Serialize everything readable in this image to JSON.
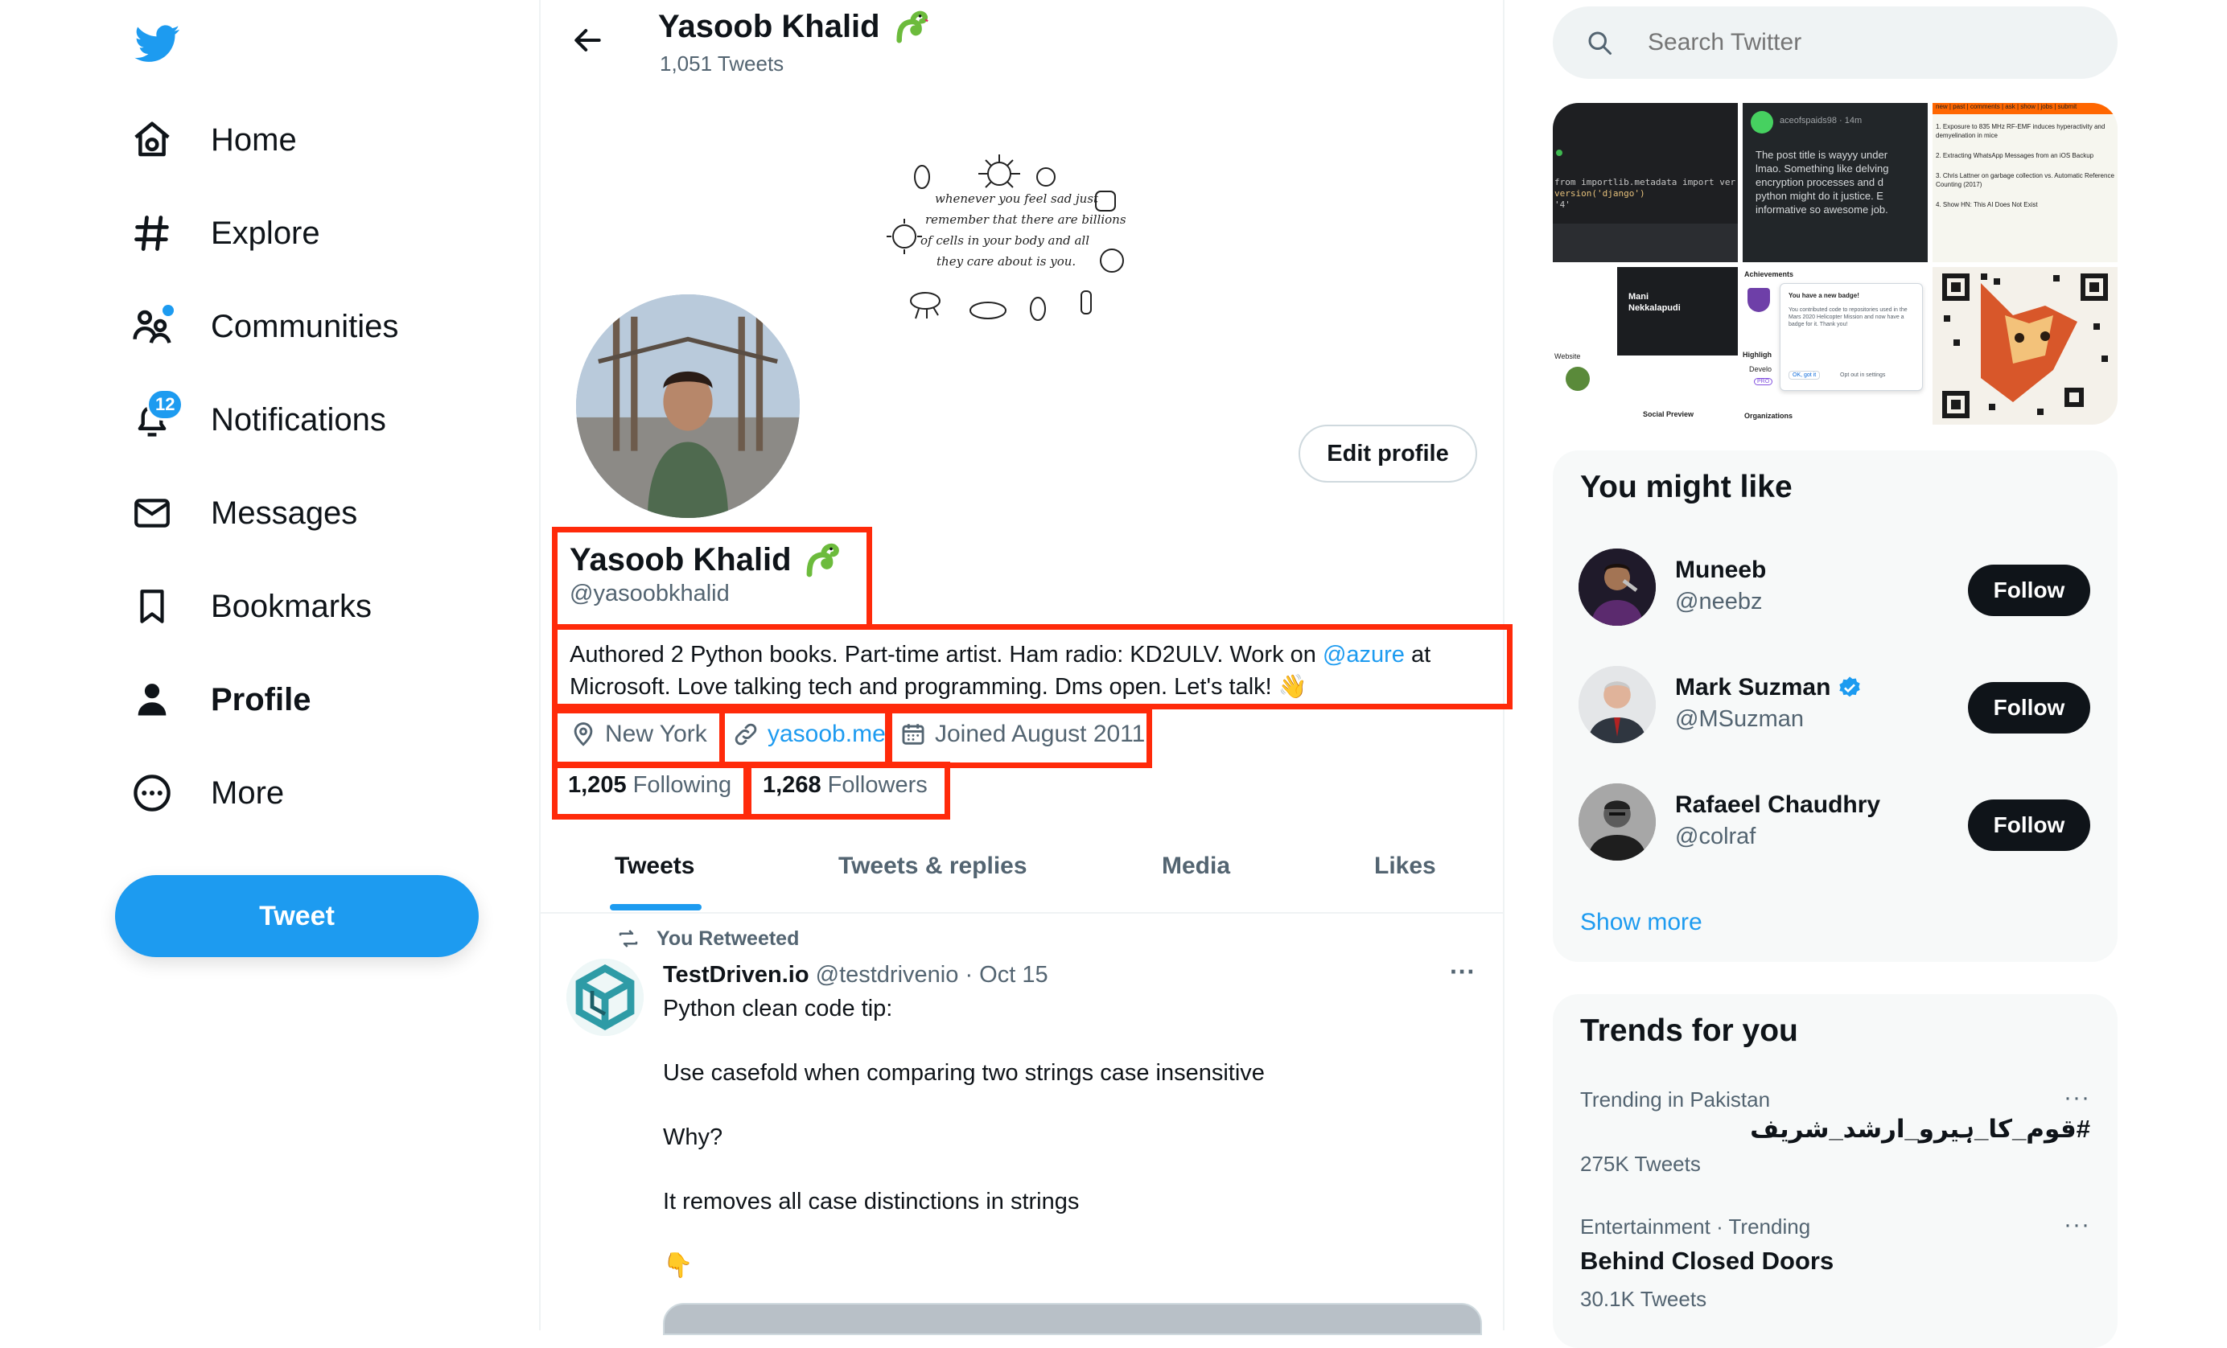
{
  "nav": {
    "items": [
      {
        "label": "Home",
        "icon": "home-icon"
      },
      {
        "label": "Explore",
        "icon": "hashtag-icon"
      },
      {
        "label": "Communities",
        "icon": "communities-icon"
      },
      {
        "label": "Notifications",
        "icon": "bell-icon",
        "badge": "12"
      },
      {
        "label": "Messages",
        "icon": "envelope-icon"
      },
      {
        "label": "Bookmarks",
        "icon": "bookmark-icon"
      },
      {
        "label": "Profile",
        "icon": "person-icon"
      },
      {
        "label": "More",
        "icon": "more-circle-icon"
      }
    ],
    "tweet_button": "Tweet"
  },
  "header": {
    "name": "Yasoob Khalid",
    "tweet_count": "1,051 Tweets"
  },
  "banner": {
    "doodle_text": [
      "whenever you feel sad just",
      "remember that there are billions",
      "of cells in your body and all",
      "they care about is you."
    ]
  },
  "profile": {
    "edit_button": "Edit profile",
    "name": "Yasoob Khalid",
    "handle": "@yasoobkhalid",
    "bio_line1_pre": "Authored 2 Python books. Part-time artist. Ham radio: KD2ULV. Work on ",
    "bio_mention": "@azure",
    "bio_line1_post": " at",
    "bio_line2": "Microsoft. Love talking tech and programming. Dms open. Let's talk!",
    "bio_emoji": "👋",
    "location": "New York",
    "website": "yasoob.me",
    "joined": "Joined August 2011",
    "following_count": "1,205",
    "following_label": "Following",
    "followers_count": "1,268",
    "followers_label": "Followers"
  },
  "tabs": [
    "Tweets",
    "Tweets & replies",
    "Media",
    "Likes"
  ],
  "tweet": {
    "retweet_label": "You Retweeted",
    "author": "TestDriven.io",
    "handle": "@testdrivenio",
    "sep": "·",
    "date": "Oct 15",
    "more": "···",
    "lines": [
      "Python clean code tip:",
      "Use casefold when comparing two strings case insensitive",
      "Why?",
      "It removes all case distinctions in strings"
    ],
    "emoji": "👇"
  },
  "search": {
    "placeholder": "Search Twitter"
  },
  "media_grid": {
    "code_line1": "from importlib.metadata import ver",
    "code_line2": "version('django')",
    "code_line3": "'4'",
    "reddit_user": "aceofspaids98 · 14m",
    "reddit_text": [
      "The post title is wayyy under",
      "lmao. Something like delving",
      "encryption processes and d",
      "python might do it justice. E",
      "informative so awesome job."
    ],
    "hn_header": "new | past | comments | ask | show | jobs | submit",
    "hn_items": [
      "1. Exposure to 835 MHz RF-EMF induces hyperactivity and demyelination in mice",
      "2. Extracting WhatsApp Messages from an iOS Backup",
      "3. Chris Lattner on garbage collection vs. Automatic Reference Counting (2017)",
      "4. Show HN: This AI Does Not Exist"
    ],
    "resume_name": [
      "Mani",
      "Nekkalapudi"
    ],
    "website_label": "Website",
    "social_preview": "Social Preview",
    "achievements": "Achievements",
    "badge_title": "You have a new badge!",
    "badge_text": "You contributed code to repositories used in the Mars 2020 Helicopter Mission and now have a badge for it. Thank you!",
    "badge_ok": "OK, got it",
    "badge_optout": "Opt out in settings",
    "highlights": "Highligh",
    "develop": "Develo",
    "pro": "PRO",
    "organizations": "Organizations"
  },
  "suggestions": {
    "title": "You might like",
    "people": [
      {
        "name": "Muneeb",
        "handle": "@neebz",
        "button": "Follow",
        "verified": false
      },
      {
        "name": "Mark Suzman",
        "handle": "@MSuzman",
        "button": "Follow",
        "verified": true
      },
      {
        "name": "Rafaeel Chaudhry",
        "handle": "@colraf",
        "button": "Follow",
        "verified": false
      }
    ],
    "show_more": "Show more"
  },
  "trends": {
    "title": "Trends for you",
    "items": [
      {
        "meta": "Trending in Pakistan",
        "name": "#قوم_کا_ہیرو_ارشد_شریف",
        "count": "275K Tweets",
        "more": "···"
      },
      {
        "meta": "Entertainment · Trending",
        "name": "Behind Closed Doors",
        "count": "30.1K Tweets",
        "more": "···"
      }
    ]
  },
  "colors": {
    "accent": "#1d9bf0",
    "highlight_box": "#ff2a0a",
    "text": "#0f1419",
    "muted": "#536471"
  }
}
